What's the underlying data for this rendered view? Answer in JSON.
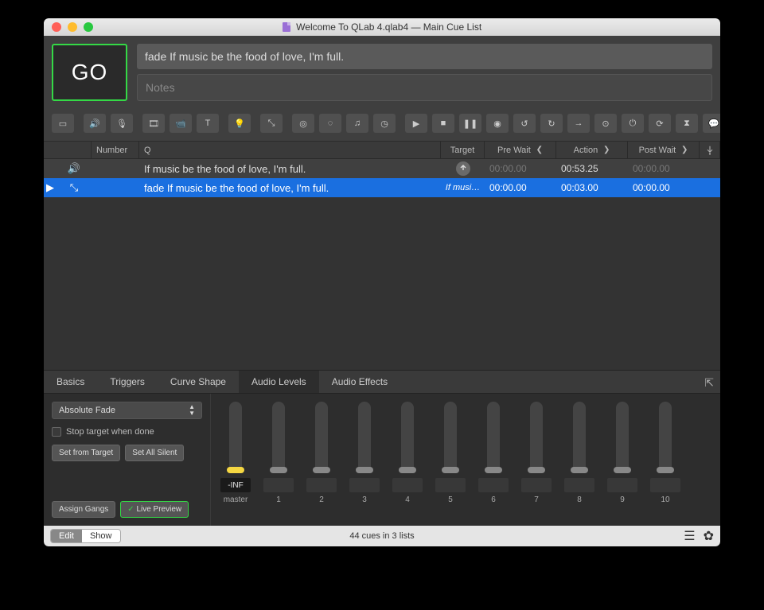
{
  "window": {
    "title": "Welcome To QLab 4.qlab4 — Main Cue List"
  },
  "go_label": "GO",
  "selected_cue_name": "fade If music be the food of love, I'm full.",
  "notes_placeholder": "Notes",
  "toolbar_icons": [
    "group-icon",
    "audio-icon",
    "mic-icon",
    "video-icon",
    "camera-icon",
    "text-icon",
    "light-icon",
    "fade-icon",
    "network-icon",
    "midi-icon",
    "midi-file-icon",
    "timecode-icon",
    "go-icon",
    "stop-icon",
    "pause-icon",
    "load-icon",
    "reset-icon",
    "devamp-icon",
    "goto-icon",
    "target-icon",
    "arm-icon",
    "disarm-icon",
    "wait-icon",
    "memo-icon",
    "script-icon"
  ],
  "columns": {
    "number": "Number",
    "q": "Q",
    "target": "Target",
    "prewait": "Pre Wait",
    "action": "Action",
    "postwait": "Post Wait"
  },
  "cues": [
    {
      "selected": false,
      "type": "audio",
      "number": "",
      "name": "If music be the food of love, I'm full.",
      "target_kind": "file",
      "prewait": "00:00.00",
      "prewait_dim": true,
      "action": "00:53.25",
      "action_dim": false,
      "postwait": "00:00.00",
      "postwait_dim": true
    },
    {
      "selected": true,
      "type": "fade",
      "number": "",
      "name": "fade If music be the food of love, I'm full.",
      "target_kind": "cue",
      "target_text": "If musi…",
      "prewait": "00:00.00",
      "prewait_dim": false,
      "action": "00:03.00",
      "action_dim": false,
      "postwait": "00:00.00",
      "postwait_dim": false
    }
  ],
  "inspector": {
    "tabs": [
      "Basics",
      "Triggers",
      "Curve Shape",
      "Audio Levels",
      "Audio Effects"
    ],
    "active_tab": 3,
    "fade_type": "Absolute Fade",
    "stop_target": "Stop target when done",
    "set_from_target": "Set from Target",
    "set_all_silent": "Set All Silent",
    "assign_gangs": "Assign Gangs",
    "live_preview": "Live Preview",
    "sliders": [
      {
        "label": "master",
        "value": "-INF",
        "active": true,
        "pos": 82
      },
      {
        "label": "1",
        "value": "",
        "active": false,
        "pos": 82
      },
      {
        "label": "2",
        "value": "",
        "active": false,
        "pos": 82
      },
      {
        "label": "3",
        "value": "",
        "active": false,
        "pos": 82
      },
      {
        "label": "4",
        "value": "",
        "active": false,
        "pos": 82
      },
      {
        "label": "5",
        "value": "",
        "active": false,
        "pos": 82
      },
      {
        "label": "6",
        "value": "",
        "active": false,
        "pos": 82
      },
      {
        "label": "7",
        "value": "",
        "active": false,
        "pos": 82
      },
      {
        "label": "8",
        "value": "",
        "active": false,
        "pos": 82
      },
      {
        "label": "9",
        "value": "",
        "active": false,
        "pos": 82
      },
      {
        "label": "10",
        "value": "",
        "active": false,
        "pos": 82
      }
    ]
  },
  "footer": {
    "edit": "Edit",
    "show": "Show",
    "status": "44 cues in 3 lists"
  }
}
